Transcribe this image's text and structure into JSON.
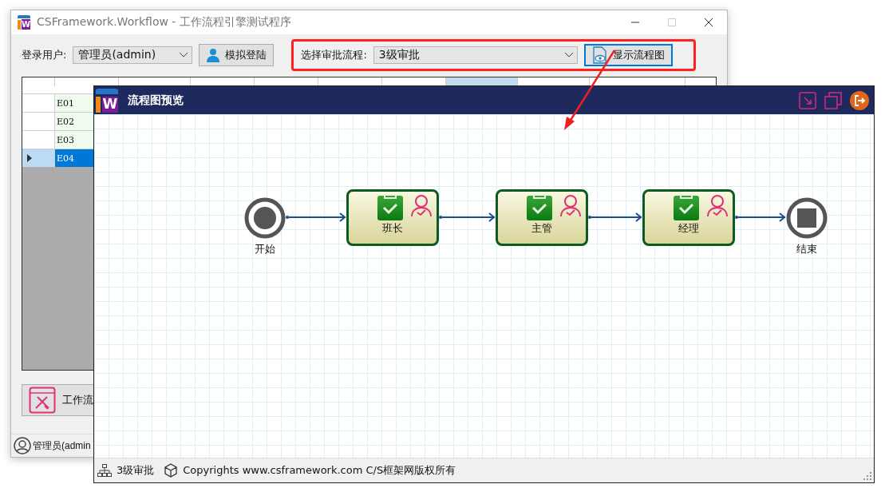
{
  "main_window": {
    "logo": "W",
    "title": "CSFramework.Workflow - 工作流程引擎测试程序",
    "login_label": "登录用户:",
    "user_select": "管理员(admin)",
    "login_button": "模拟登陆",
    "flow_label": "选择审批流程:",
    "flow_select": "3级审批",
    "show_button": "显示流程图",
    "table": {
      "columns": [
        {
          "selected": false
        },
        {
          "selected": false
        },
        {
          "selected": false
        },
        {
          "selected": false
        },
        {
          "selected": false
        },
        {
          "selected": false
        },
        {
          "selected": true
        },
        {
          "selected": false
        },
        {
          "selected": false
        }
      ],
      "rows": [
        {
          "code": "E01",
          "selected": false
        },
        {
          "code": "E02",
          "selected": false
        },
        {
          "code": "E03",
          "selected": false
        },
        {
          "code": "E04",
          "selected": true
        }
      ]
    },
    "designer_button": "工作流",
    "status_user": "管理员(admin"
  },
  "preview_window": {
    "logo": "W",
    "title": "流程图预览",
    "nodes": [
      {
        "kind": "start",
        "label": "开始"
      },
      {
        "kind": "task",
        "label": "班长"
      },
      {
        "kind": "task",
        "label": "主管"
      },
      {
        "kind": "task",
        "label": "经理"
      },
      {
        "kind": "end",
        "label": "结束"
      }
    ],
    "status_flow": "3级审批",
    "copyright": "Copyrights www.csframework.com C/S框架网版权所有"
  }
}
